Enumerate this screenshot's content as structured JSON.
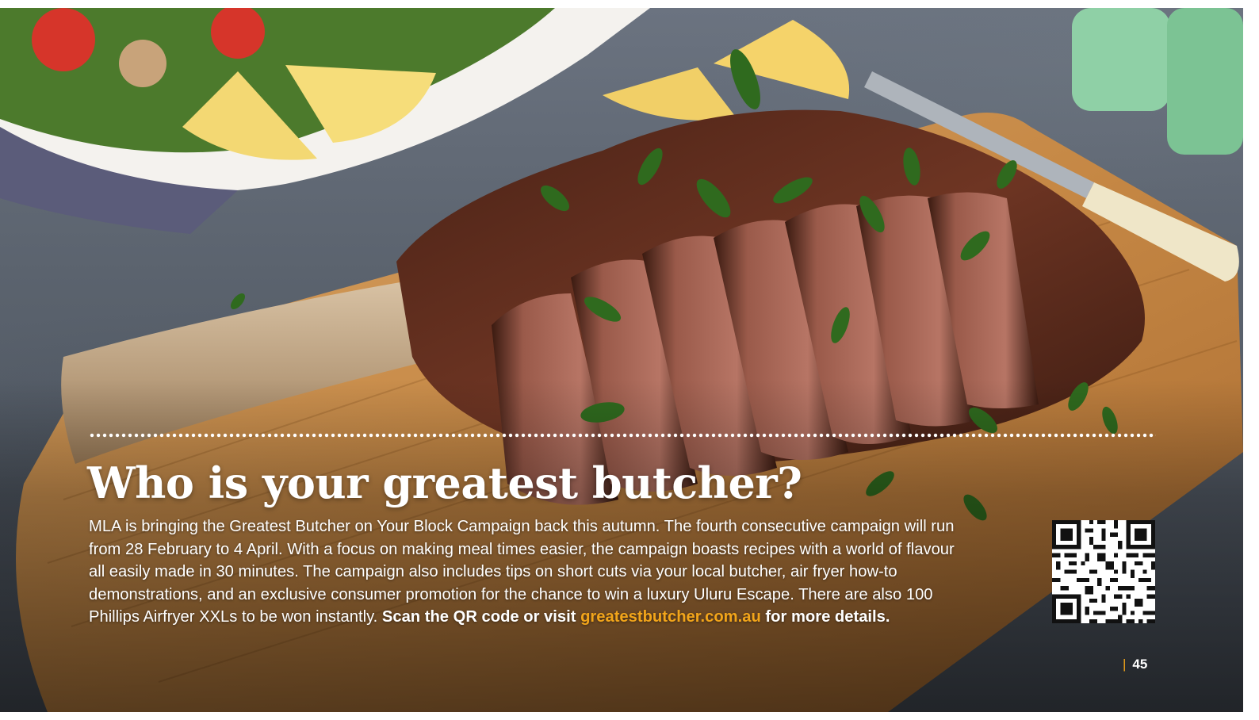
{
  "article": {
    "headline": "Who is your greatest butcher?",
    "body_lines": [
      "MLA is bringing the Greatest Butcher on Your Block Campaign back this autumn. The fourth consecutive campaign will run",
      "from 28 February to 4 April. With a focus on making meal times easier, the campaign boasts recipes with a world of flavour",
      "all easily made in 30 minutes. The campaign also includes tips on short cuts via your local butcher, air fryer how-to",
      "demonstrations, and an exclusive consumer promotion for the chance to win a luxury Uluru Escape. There are also 100"
    ],
    "last_line_plain": "Phillips Airfryer XXLs to be won instantly. ",
    "cta_prefix": "Scan the QR code or visit ",
    "cta_link": "greatestbutcher.com.au",
    "cta_suffix": " for more details."
  },
  "page_number": "45",
  "colors": {
    "accent": "#f2a51a",
    "text": "#ffffff",
    "board": "#c98a48",
    "meat": "#6a3322"
  },
  "icons": {
    "qr": "qr-code"
  }
}
